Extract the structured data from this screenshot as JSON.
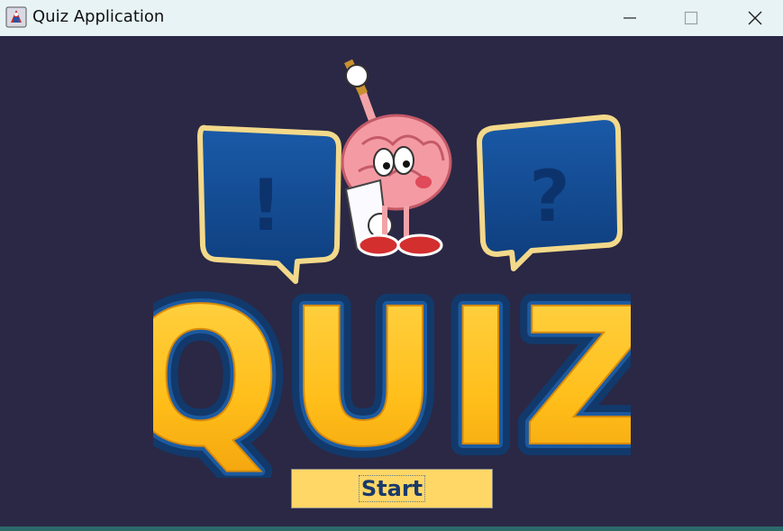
{
  "window": {
    "title": "Quiz Application",
    "controls": {
      "minimize": "minimize-icon",
      "maximize": "maximize-icon",
      "close": "close-icon"
    }
  },
  "logo": {
    "text": "QUIZ",
    "left_bubble_symbol": "!",
    "right_bubble_symbol": "?",
    "mascot": "brain-mascot-icon"
  },
  "actions": {
    "start_label": "Start"
  },
  "colors": {
    "background": "#2a2845",
    "titlebar": "#e8f3f6",
    "logo_fill": "#ffc21f",
    "logo_outline": "#12396b",
    "button_fill": "#ffd766",
    "button_text": "#1a3a6a"
  }
}
